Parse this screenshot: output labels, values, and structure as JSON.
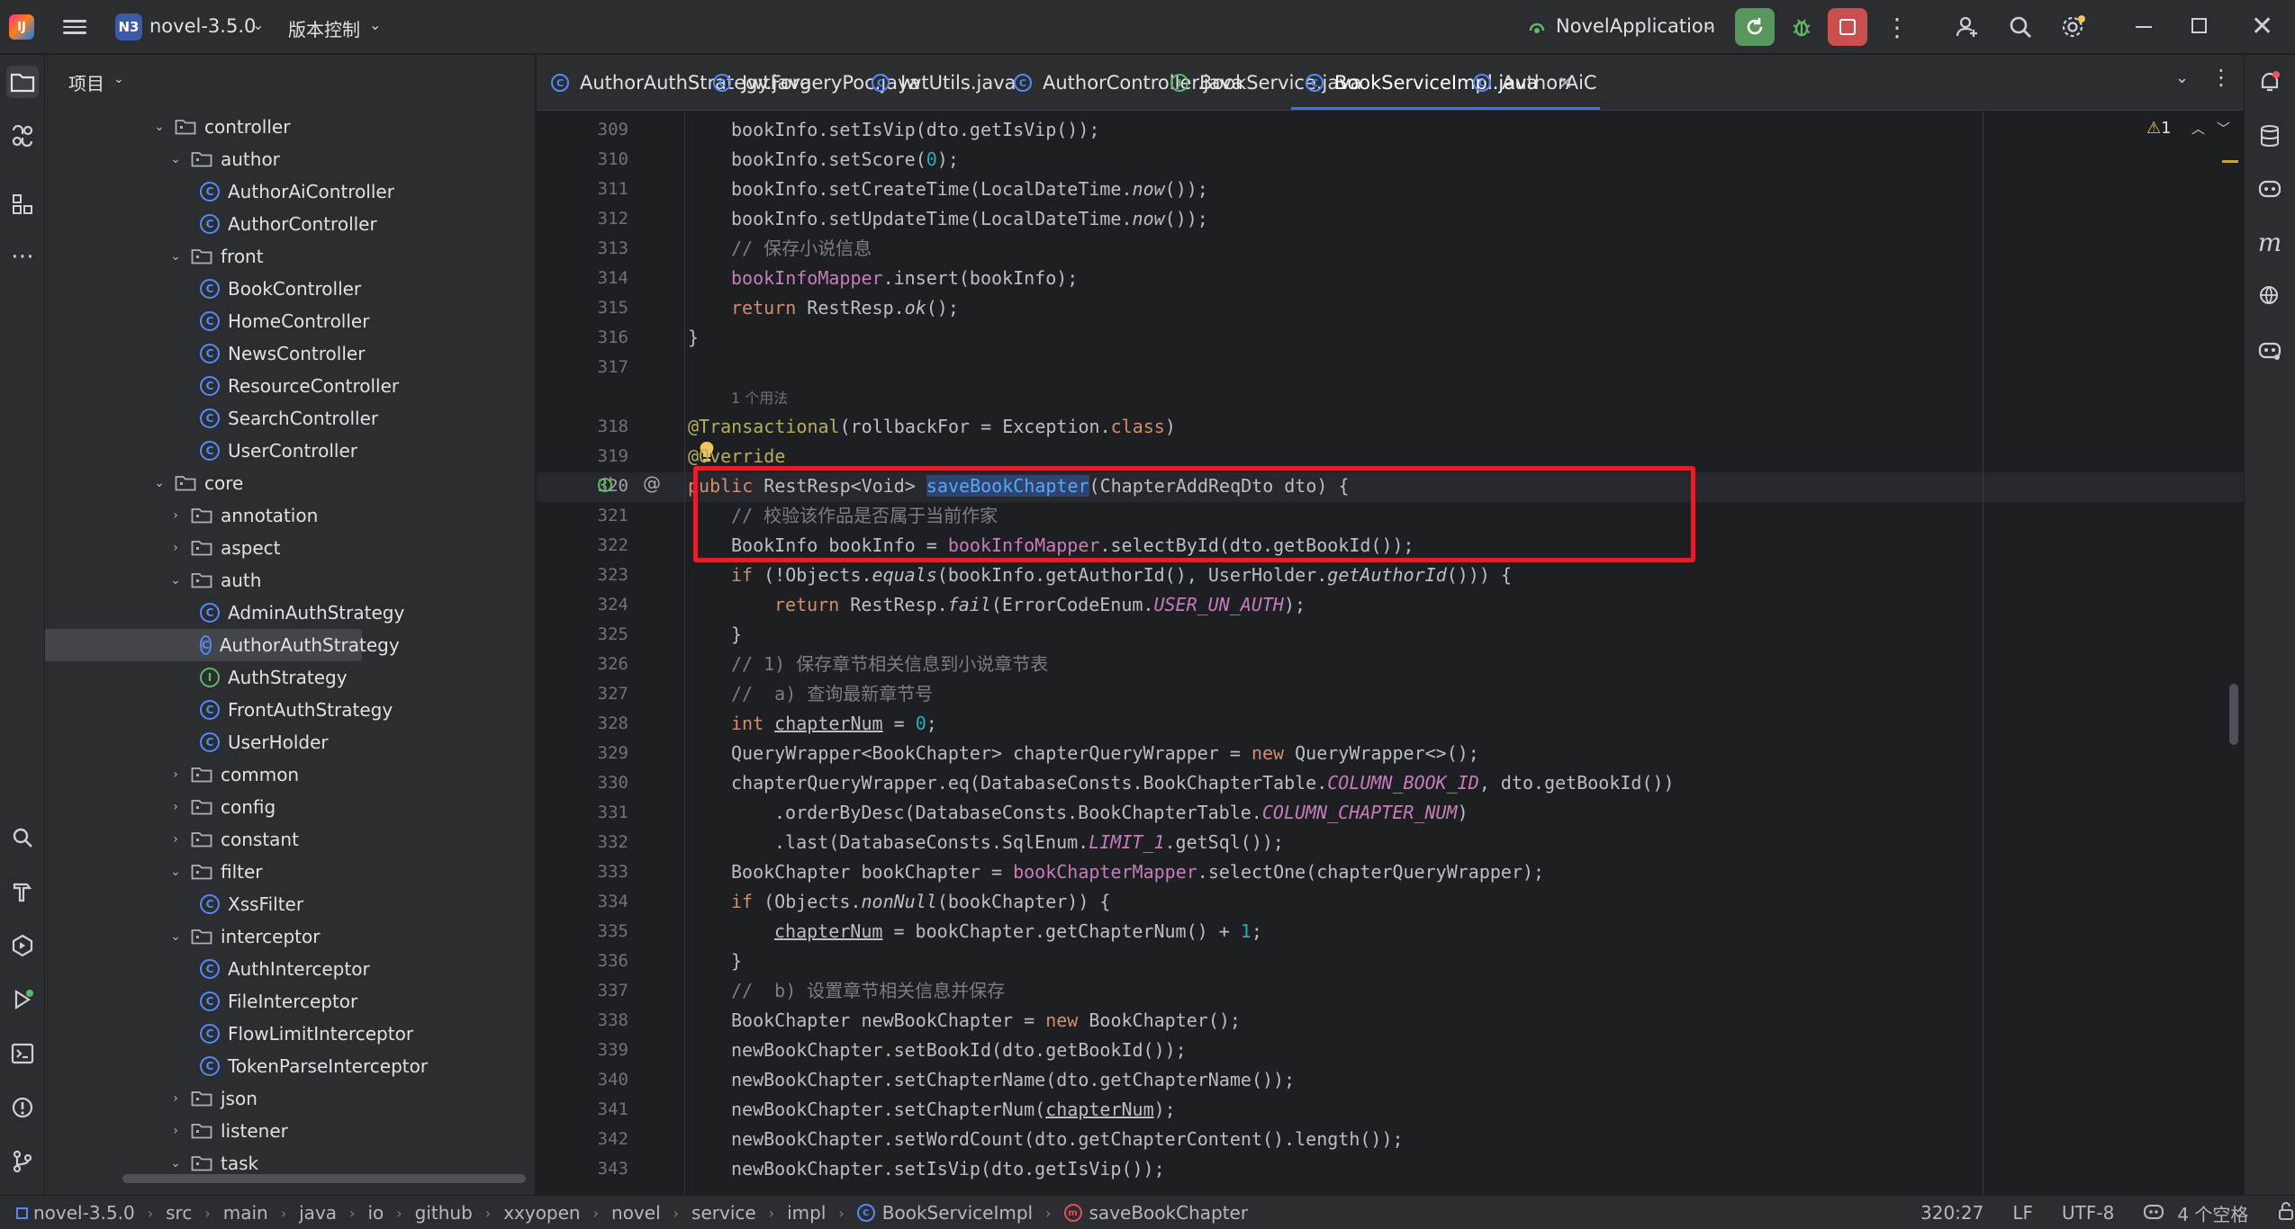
{
  "titlebar": {
    "app_logo": "IJ",
    "project_badge": "N3",
    "project_name": "novel-3.5.0",
    "vcs_label": "版本控制",
    "run_config": "NovelApplication",
    "icons": [
      "hamburger-icon",
      "chevron-down-icon",
      "rerun-icon",
      "debug-icon",
      "stop-icon",
      "more-icon",
      "add-user-icon",
      "search-icon",
      "gear-icon",
      "minimize-icon",
      "maximize-icon",
      "close-icon"
    ]
  },
  "project_panel": {
    "header": "项目",
    "tree": [
      {
        "label": "controller",
        "kind": "folder",
        "depth": 0,
        "open": true
      },
      {
        "label": "author",
        "kind": "folder",
        "depth": 1,
        "open": true
      },
      {
        "label": "AuthorAiController",
        "kind": "class",
        "depth": 2
      },
      {
        "label": "AuthorController",
        "kind": "class",
        "depth": 2
      },
      {
        "label": "front",
        "kind": "folder",
        "depth": 1,
        "open": true
      },
      {
        "label": "BookController",
        "kind": "class",
        "depth": 2
      },
      {
        "label": "HomeController",
        "kind": "class",
        "depth": 2
      },
      {
        "label": "NewsController",
        "kind": "class",
        "depth": 2
      },
      {
        "label": "ResourceController",
        "kind": "class",
        "depth": 2
      },
      {
        "label": "SearchController",
        "kind": "class",
        "depth": 2
      },
      {
        "label": "UserController",
        "kind": "class",
        "depth": 2
      },
      {
        "label": "core",
        "kind": "folder",
        "depth": 0,
        "open": true
      },
      {
        "label": "annotation",
        "kind": "folder",
        "depth": 1,
        "open": false
      },
      {
        "label": "aspect",
        "kind": "folder",
        "depth": 1,
        "open": false
      },
      {
        "label": "auth",
        "kind": "folder",
        "depth": 1,
        "open": true
      },
      {
        "label": "AdminAuthStrategy",
        "kind": "class",
        "depth": 2
      },
      {
        "label": "AuthorAuthStrategy",
        "kind": "class",
        "depth": 2,
        "selected": true
      },
      {
        "label": "AuthStrategy",
        "kind": "interface",
        "depth": 2
      },
      {
        "label": "FrontAuthStrategy",
        "kind": "class",
        "depth": 2
      },
      {
        "label": "UserHolder",
        "kind": "class",
        "depth": 2
      },
      {
        "label": "common",
        "kind": "folder",
        "depth": 1,
        "open": false
      },
      {
        "label": "config",
        "kind": "folder",
        "depth": 1,
        "open": false
      },
      {
        "label": "constant",
        "kind": "folder",
        "depth": 1,
        "open": false
      },
      {
        "label": "filter",
        "kind": "folder",
        "depth": 1,
        "open": true
      },
      {
        "label": "XssFilter",
        "kind": "class",
        "depth": 2
      },
      {
        "label": "interceptor",
        "kind": "folder",
        "depth": 1,
        "open": true
      },
      {
        "label": "AuthInterceptor",
        "kind": "class",
        "depth": 2
      },
      {
        "label": "FileInterceptor",
        "kind": "class",
        "depth": 2
      },
      {
        "label": "FlowLimitInterceptor",
        "kind": "class",
        "depth": 2
      },
      {
        "label": "TokenParseInterceptor",
        "kind": "class",
        "depth": 2
      },
      {
        "label": "json",
        "kind": "folder",
        "depth": 1,
        "open": false
      },
      {
        "label": "listener",
        "kind": "folder",
        "depth": 1,
        "open": false
      },
      {
        "label": "task",
        "kind": "folder",
        "depth": 1,
        "open": true
      }
    ]
  },
  "tabs": [
    {
      "label": "AuthorAuthStrategy.java",
      "kind": "class"
    },
    {
      "label": "JwtForgeryPoc.java",
      "kind": "class"
    },
    {
      "label": "JwtUtils.java",
      "kind": "class"
    },
    {
      "label": "AuthorController.java",
      "kind": "class"
    },
    {
      "label": "BookService.java",
      "kind": "interface"
    },
    {
      "label": "BookServiceImpl.java",
      "kind": "class",
      "active": true
    },
    {
      "label": "AuthorAiC",
      "kind": "class"
    }
  ],
  "editor": {
    "warning_count": "1",
    "usage_hint": "1 个用法",
    "line_numbers": [
      "309",
      "310",
      "311",
      "312",
      "313",
      "314",
      "315",
      "316",
      "317",
      "318",
      "319",
      "320",
      "321",
      "322",
      "323",
      "324",
      "325",
      "326",
      "327",
      "328",
      "329",
      "330",
      "331",
      "332",
      "333",
      "334",
      "335",
      "336",
      "337",
      "338",
      "339",
      "340",
      "341",
      "342",
      "343"
    ],
    "current_line": "320"
  },
  "statusbar": {
    "breadcrumbs": [
      "novel-3.5.0",
      "src",
      "main",
      "java",
      "io",
      "github",
      "xxyopen",
      "novel",
      "service",
      "impl",
      "BookServiceImpl",
      "saveBookChapter"
    ],
    "position": "320:27",
    "line_sep": "LF",
    "encoding": "UTF-8",
    "indent": "4 个空格"
  }
}
